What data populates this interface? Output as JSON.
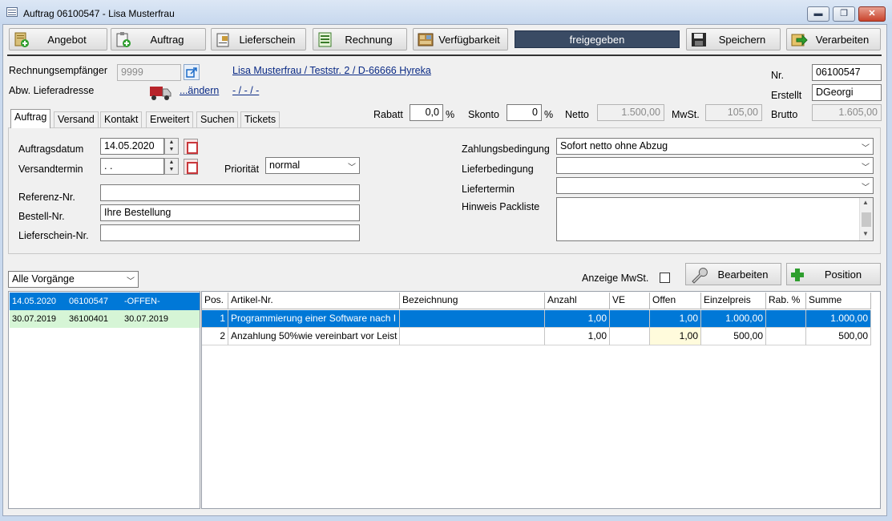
{
  "window": {
    "title": "Auftrag 06100547 - Lisa Musterfrau",
    "min": "▬",
    "max": "❐",
    "close": "✕"
  },
  "toolbar": {
    "angebot": "Angebot",
    "auftrag": "Auftrag",
    "lieferschein": "Lieferschein",
    "rechnung": "Rechnung",
    "verfuegbarkeit": "Verfügbarkeit",
    "status": "freigegeben",
    "speichern": "Speichern",
    "verarbeiten": "Verarbeiten"
  },
  "header": {
    "rechnungsempfaenger_label": "Rechnungsempfänger",
    "rechnungsempfaenger_value": "9999",
    "address_link": "Lisa Musterfrau / Teststr. 2 / D-66666 Hyreka",
    "abw_label": "Abw. Lieferadresse",
    "aendern_link": "...ändern",
    "abw_value": "- / - / -",
    "nr_label": "Nr.",
    "nr_value": "06100547",
    "erstellt_label": "Erstellt",
    "erstellt_value": "DGeorgi",
    "rabatt_label": "Rabatt",
    "rabatt_value": "0,0",
    "rabatt_unit": "%",
    "skonto_label": "Skonto",
    "skonto_value": "0",
    "skonto_unit": "%",
    "netto_label": "Netto",
    "netto_value": "1.500,00",
    "mwst_label": "MwSt.",
    "mwst_value": "105,00",
    "brutto_label": "Brutto",
    "brutto_value": "1.605,00"
  },
  "tabs": [
    "Auftrag",
    "Versand",
    "Kontakt",
    "Erweitert",
    "Suchen",
    "Tickets"
  ],
  "form": {
    "auftragsdatum_label": "Auftragsdatum",
    "auftragsdatum_value": "14.05.2020",
    "versandtermin_label": "Versandtermin",
    "versandtermin_value": " .  .",
    "prioritaet_label": "Priorität",
    "prioritaet_value": "normal",
    "referenz_label": "Referenz-Nr.",
    "referenz_value": "",
    "bestell_label": "Bestell-Nr.",
    "bestell_value": "Ihre Bestellung",
    "lieferschein_label": "Lieferschein-Nr.",
    "lieferschein_value": "",
    "zahlungsbedingung_label": "Zahlungsbedingung",
    "zahlungsbedingung_value": "Sofort netto ohne Abzug",
    "lieferbedingung_label": "Lieferbedingung",
    "lieferbedingung_value": "",
    "liefertermin_label": "Liefertermin",
    "liefertermin_value": "",
    "hinweis_label": "Hinweis Packliste",
    "hinweis_value": ""
  },
  "lower": {
    "filter_value": "Alle Vorgänge",
    "anzeige_mwst_label": "Anzeige MwSt.",
    "bearbeiten": "Bearbeiten",
    "position": "Position"
  },
  "vorgaenge": [
    {
      "date": "14.05.2020",
      "nr": "06100547",
      "status": "-OFFEN-"
    },
    {
      "date": "30.07.2019",
      "nr": "36100401",
      "status": "30.07.2019"
    }
  ],
  "grid": {
    "columns": [
      "Pos.",
      "Artikel-Nr.",
      "Bezeichnung",
      "Anzahl",
      "VE",
      "Offen",
      "Einzelpreis",
      "Rab. %",
      "Summe"
    ],
    "rows": [
      {
        "pos": "1",
        "artikel": "Programmierung einer Software nach I",
        "bez": "",
        "anzahl": "1,00",
        "ve": "",
        "offen": "1,00",
        "preis": "1.000,00",
        "rab": "",
        "summe": "1.000,00"
      },
      {
        "pos": "2",
        "artikel": "Anzahlung 50%wie vereinbart vor Leist",
        "bez": "",
        "anzahl": "1,00",
        "ve": "",
        "offen": "1,00",
        "preis": "500,00",
        "rab": "",
        "summe": "500,00"
      }
    ]
  }
}
